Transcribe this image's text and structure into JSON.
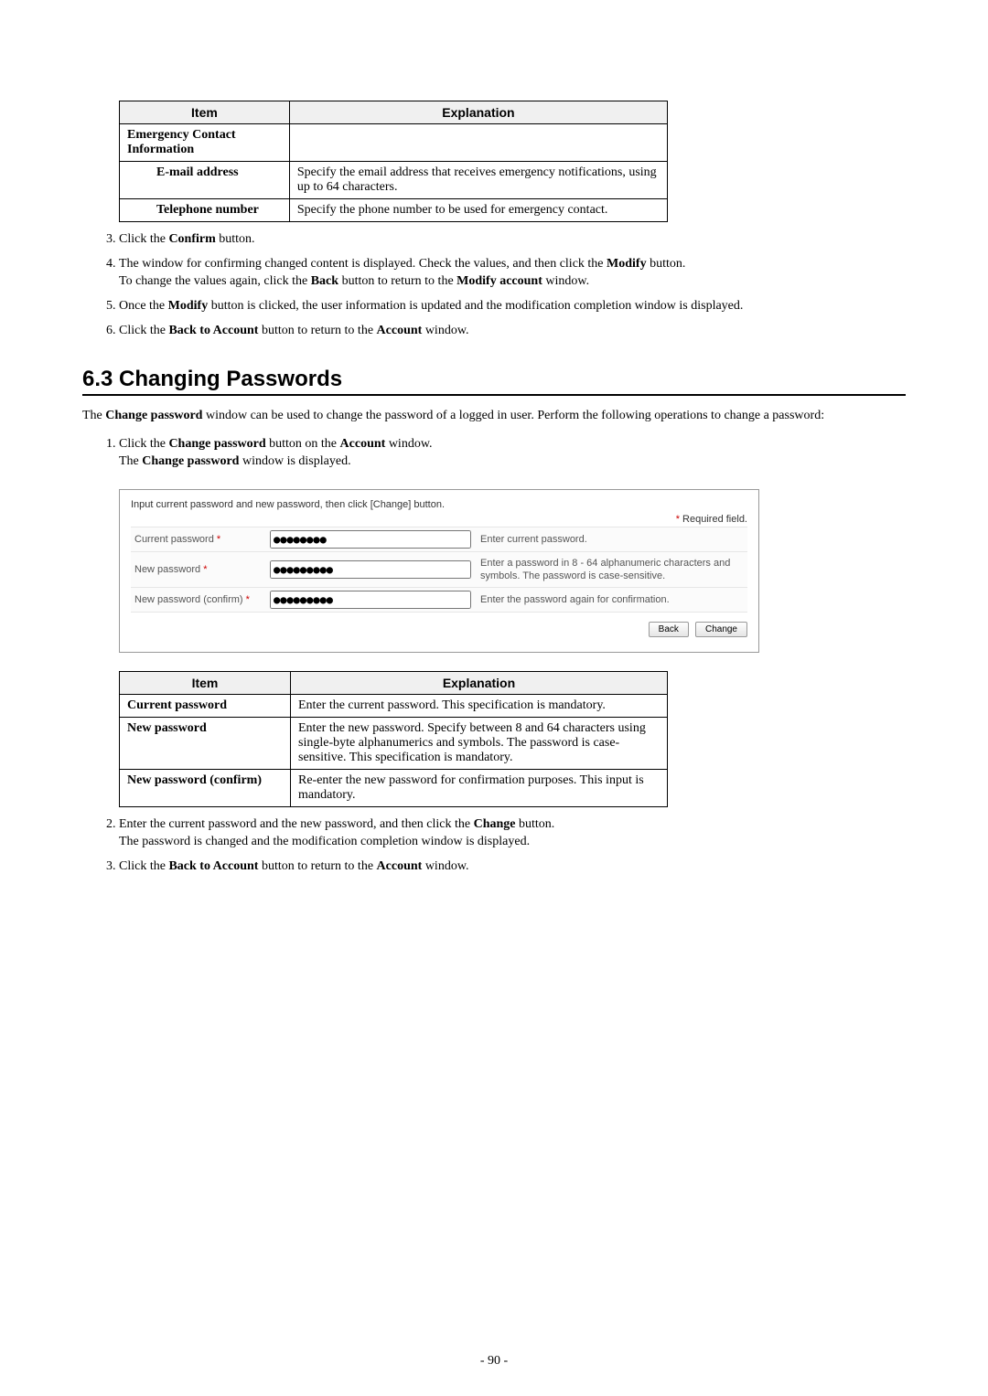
{
  "table1": {
    "head_item": "Item",
    "head_expl": "Explanation",
    "row0_item": "Emergency Contact Information",
    "row0_expl": "",
    "row1_item": "E-mail address",
    "row1_expl": "Specify the email address that receives emergency notifications, using up to 64 characters.",
    "row2_item": "Telephone number",
    "row2_expl": "Specify the phone number to be used for emergency contact."
  },
  "steps_a": {
    "s3_a": "Click the ",
    "s3_b": "Confirm",
    "s3_c": " button.",
    "s4_a": "The window for confirming changed content is displayed. Check the values, and then click the ",
    "s4_b": "Modify",
    "s4_c": " button.",
    "s4_d": "To change the values again, click the ",
    "s4_e": "Back",
    "s4_f": " button to return to the ",
    "s4_g": "Modify account",
    "s4_h": " window.",
    "s5_a": "Once the ",
    "s5_b": "Modify",
    "s5_c": " button is clicked, the user information is updated and the modification completion window is displayed.",
    "s6_a": "Click the ",
    "s6_b": "Back to Account",
    "s6_c": " button to return to the ",
    "s6_d": "Account",
    "s6_e": " window."
  },
  "section_heading": "6.3  Changing Passwords",
  "para_intro_a": "The ",
  "para_intro_b": "Change password",
  "para_intro_c": " window can be used to change the password of a logged in user. Perform the following operations to change a password:",
  "steps_b": {
    "s1_a": "Click the ",
    "s1_b": "Change password",
    "s1_c": " button on the ",
    "s1_d": "Account",
    "s1_e": " window.",
    "s1_f": "The ",
    "s1_g": "Change password",
    "s1_h": " window is displayed."
  },
  "mock": {
    "hint": "Input current password and new password, then click [Change] button.",
    "required_star": "*",
    "required_text": " Required field.",
    "lbl_cur": "Current password ",
    "lbl_new": "New password ",
    "lbl_conf": "New password (confirm) ",
    "val_cur": "●●●●●●●●",
    "val_new": "●●●●●●●●●",
    "val_conf": "●●●●●●●●●",
    "desc_cur": "Enter current password.",
    "desc_new": "Enter a password in 8 - 64 alphanumeric characters and symbols. The password is case-sensitive.",
    "desc_conf": "Enter the password again for confirmation.",
    "btn_back": "Back",
    "btn_change": "Change"
  },
  "table2": {
    "head_item": "Item",
    "head_expl": "Explanation",
    "r0_item": "Current password",
    "r0_expl": "Enter the current password. This specification is mandatory.",
    "r1_item": "New password",
    "r1_expl": "Enter the new password. Specify between 8 and 64 characters using single-byte alphanumerics and symbols. The password is case-sensitive. This specification is mandatory.",
    "r2_item": "New password (confirm)",
    "r2_expl": "Re-enter the new password for confirmation purposes. This input is mandatory."
  },
  "steps_c": {
    "s2_a": "Enter the current password and the new password, and then click the ",
    "s2_b": "Change",
    "s2_c": " button.",
    "s2_d": "The password is changed and the modification completion window is displayed.",
    "s3_a": "Click the ",
    "s3_b": "Back to Account",
    "s3_c": " button to return to the ",
    "s3_d": "Account",
    "s3_e": " window."
  },
  "page_number": "- 90 -"
}
